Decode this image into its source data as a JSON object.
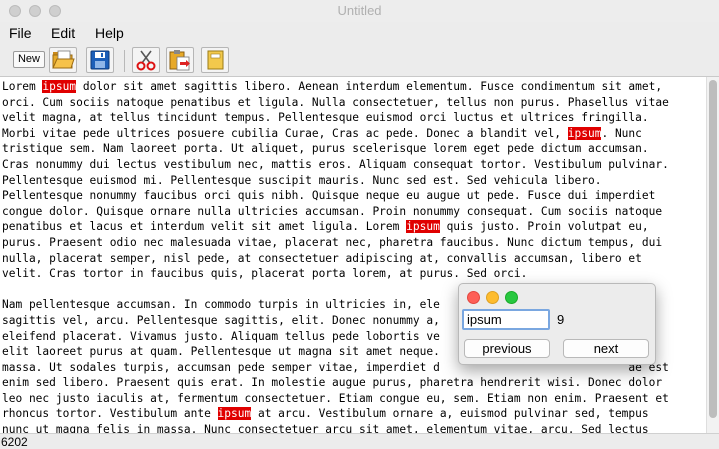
{
  "window": {
    "title": "Untitled"
  },
  "menu": {
    "file": "File",
    "edit": "Edit",
    "help": "Help"
  },
  "toolbar": {
    "new_label": "New"
  },
  "editor": {
    "text": [
      [
        {
          "t": "Lorem "
        },
        {
          "t": "ipsum",
          "hl": true
        },
        {
          "t": " dolor sit amet sagittis libero. Aenean interdum elementum. Fusce condimentum sit amet,"
        }
      ],
      [
        {
          "t": "orci. Cum sociis natoque penatibus et ligula. Nulla consectetuer, tellus non purus. Phasellus vitae"
        }
      ],
      [
        {
          "t": "velit magna, at tellus tincidunt tempus. Pellentesque euismod orci luctus et ultrices fringilla."
        }
      ],
      [
        {
          "t": "Morbi vitae pede ultrices posuere cubilia Curae, Cras ac pede. Donec a blandit vel, "
        },
        {
          "t": "ipsum",
          "hl": true
        },
        {
          "t": ". Nunc"
        }
      ],
      [
        {
          "t": "tristique sem. Nam laoreet porta. Ut aliquet, purus scelerisque lorem eget pede dictum accumsan."
        }
      ],
      [
        {
          "t": "Cras nonummy dui lectus vestibulum nec, mattis eros. Aliquam consequat tortor. Vestibulum pulvinar."
        }
      ],
      [
        {
          "t": "Pellentesque euismod mi. Pellentesque suscipit mauris. Nunc sed est. Sed vehicula libero."
        }
      ],
      [
        {
          "t": "Pellentesque nonummy faucibus orci quis nibh. Quisque neque eu augue ut pede. Fusce dui imperdiet"
        }
      ],
      [
        {
          "t": "congue dolor. Quisque ornare nulla ultricies accumsan. Proin nonummy consequat. Cum sociis natoque"
        }
      ],
      [
        {
          "t": "penatibus et lacus et interdum velit sit amet ligula. Lorem "
        },
        {
          "t": "ipsum",
          "hl": true
        },
        {
          "t": " quis justo. Proin volutpat eu,"
        }
      ],
      [
        {
          "t": "purus. Praesent odio nec malesuada vitae, placerat nec, pharetra faucibus. Nunc dictum tempus, dui"
        }
      ],
      [
        {
          "t": "nulla, placerat semper, nisl pede, at consectetuer adipiscing at, convallis accumsan, libero et"
        }
      ],
      [
        {
          "t": "velit. Cras tortor in faucibus quis, placerat porta lorem, at purus. Sed orci."
        }
      ],
      [
        {
          "t": ""
        }
      ],
      [
        {
          "t": "Nam pellentesque accumsan. In commodo turpis in ultricies in, ele"
        }
      ],
      [
        {
          "t": "sagittis vel, arcu. Pellentesque sagittis, elit. Donec nonummy a,"
        }
      ],
      [
        {
          "t": "eleifend placerat. Vivamus justo. Aliquam tellus pede lobortis ve                            nas"
        }
      ],
      [
        {
          "t": "elit laoreet purus at quam. Pellentesque ut magna sit amet neque.                             la"
        }
      ],
      [
        {
          "t": "massa. Ut sodales turpis, accumsan pede semper vitae, imperdiet d                            ae est"
        }
      ],
      [
        {
          "t": "enim sed libero. Praesent quis erat. In molestie augue purus, pharetra hendrerit wisi. Donec dolor"
        }
      ],
      [
        {
          "t": "leo nec justo iaculis at, fermentum consectetuer. Etiam congue eu, sem. Etiam non enim. Praesent et"
        }
      ],
      [
        {
          "t": "rhoncus tortor. Vestibulum ante "
        },
        {
          "t": "ipsum",
          "hl": true
        },
        {
          "t": " at arcu. Vestibulum ornare a, euismod pulvinar sed, tempus"
        }
      ],
      [
        {
          "t": "nunc ut magna felis in massa. Nunc consectetuer arcu sit amet, elementum vitae, arcu. Sed lectus"
        }
      ]
    ]
  },
  "status": {
    "text": "6202"
  },
  "find_dialog": {
    "query": "ipsum",
    "count": "9",
    "previous_label": "previous",
    "next_label": "next"
  },
  "colors": {
    "highlight": "#e00000",
    "dialog_close": "#fe5f57",
    "dialog_minimize": "#febc2e",
    "dialog_zoom": "#28c840",
    "focus_ring": "#7aa7e0"
  },
  "icons": [
    "open-folder-icon",
    "save-disk-icon",
    "cut-scissors-icon",
    "paste-icon",
    "note-icon"
  ]
}
